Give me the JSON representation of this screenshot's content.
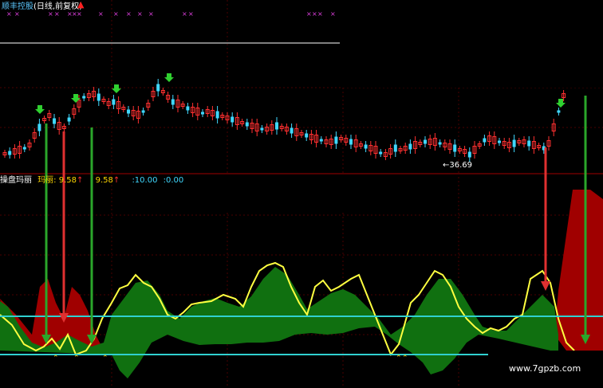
{
  "top_panel": {
    "stock_name": "顺丰控股",
    "period_label": "(日线,前复权)",
    "colors": {
      "name": "#5cc8ff",
      "period": "#ffffff",
      "marks": "#e040e0",
      "up_arrow": "#ff2020"
    }
  },
  "price_panel": {
    "low_price_label": "36.69",
    "colors": {
      "up_candle": "#ff3030",
      "down_candle": "#40d8ff",
      "buy_arrow": "#30d030",
      "grid": "#4a0000"
    }
  },
  "indicator_panel": {
    "name": "操盘玛丽",
    "mali_label": "玛丽:",
    "value_1": "9.58",
    "value_2": "9.58",
    "value_3": ":10.00",
    "value_4": ":0.00",
    "colors": {
      "name": "#ffffff",
      "mali": "#ffd700",
      "values": "#ffd700",
      "small_values": "#40d8ff",
      "green_area": "#107010",
      "red_area": "#a00000",
      "yellow_line": "#ffff40",
      "cyan_line": "#30d0d0"
    }
  },
  "watermark": "www.7gpzb.com"
}
